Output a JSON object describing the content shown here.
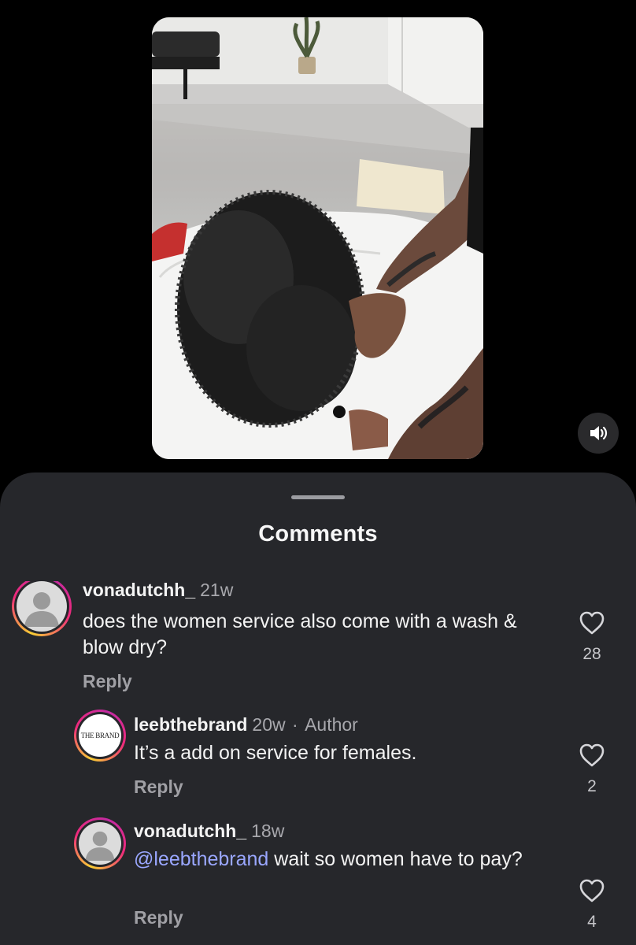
{
  "video": {
    "sound_icon": "speaker-wave-icon"
  },
  "sheet": {
    "title": "Comments"
  },
  "comments": [
    {
      "username": "vonadutchh_",
      "time": "21w",
      "text": "does the women service also come with a wash & blow dry?",
      "reply_label": "Reply",
      "likes": "28",
      "avatar": "default-avatar-icon"
    },
    {
      "username": "leebthebrand",
      "time": "20w",
      "separator": "·",
      "author_badge": "Author",
      "text": "It’s a add on service for females.",
      "reply_label": "Reply",
      "likes": "2",
      "avatar_logo_text": "THE BRAND"
    },
    {
      "username": "vonadutchh_",
      "time": "18w",
      "mention": "@leebthebrand",
      "text": " wait so women have to pay?",
      "reply_label": "Reply",
      "likes": "4",
      "avatar": "default-avatar-icon"
    }
  ],
  "colors": {
    "sheet_bg": "#26272b",
    "mention": "#9aa7ff",
    "secondary_text": "#a8a8ad"
  }
}
